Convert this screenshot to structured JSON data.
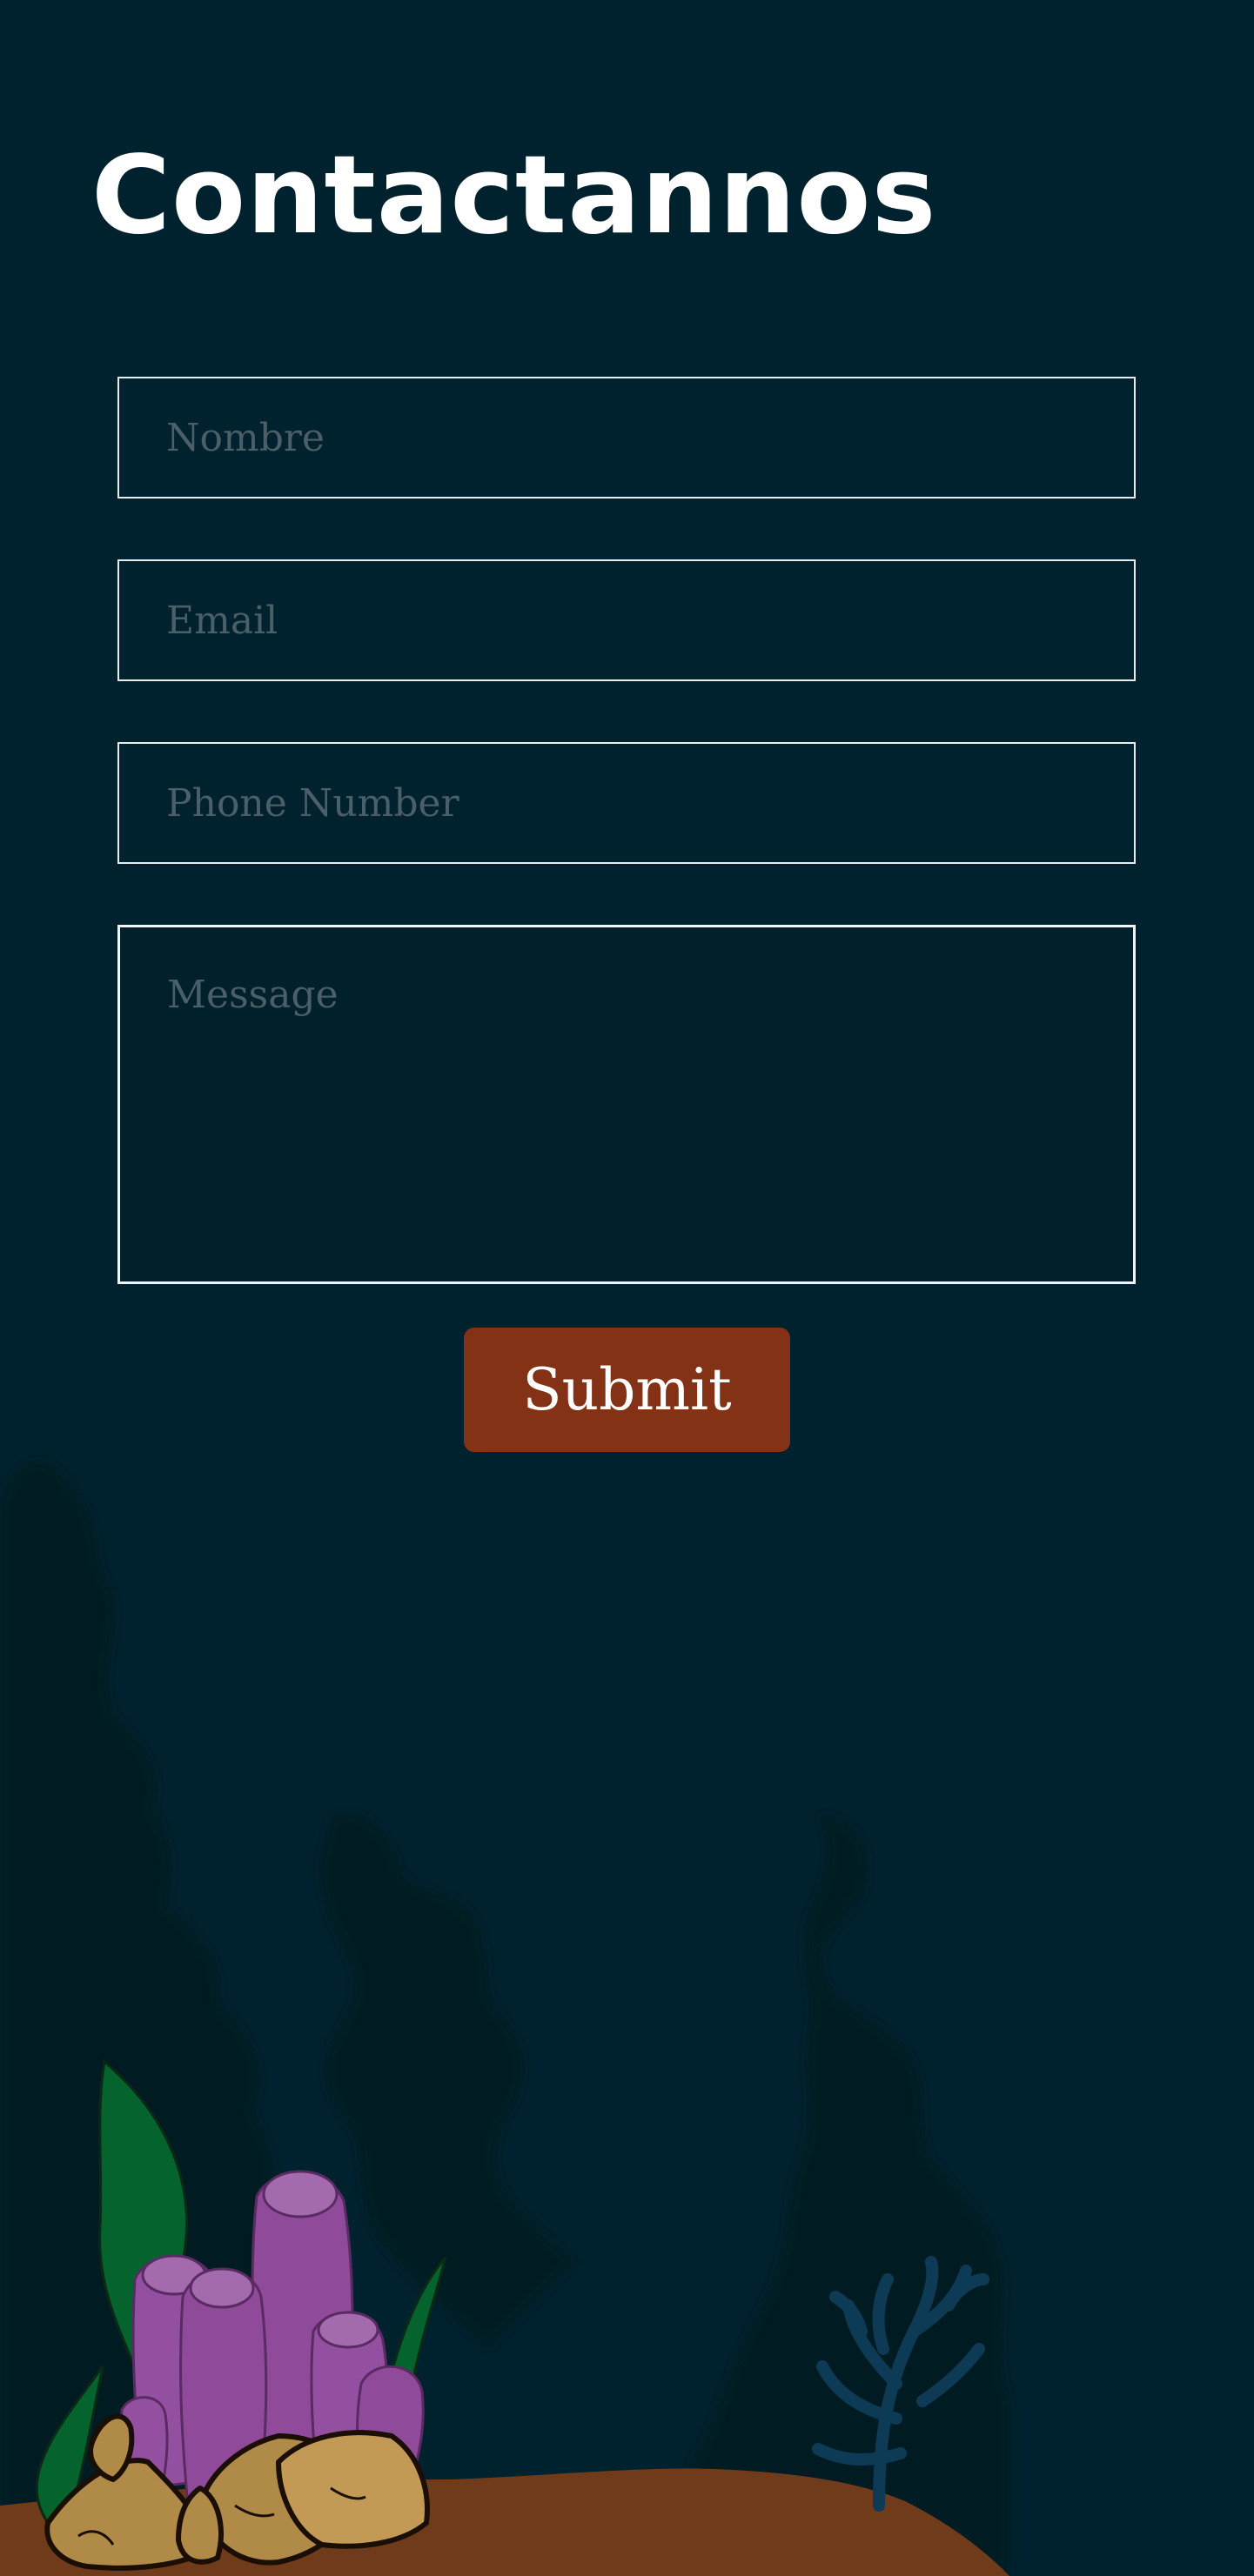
{
  "page": {
    "title": "Contactannos",
    "background_color": "#00222f"
  },
  "form": {
    "name_placeholder": "Nombre",
    "email_placeholder": "Email",
    "phone_placeholder": "Phone Number",
    "message_placeholder": "Message",
    "submit_label": "Submit",
    "submit_color": "#843216"
  },
  "illustration": {
    "icons": [
      "kelp-silhouette-icon",
      "seaweed-icon",
      "purple-coral-icon",
      "blue-coral-icon",
      "rock-icon",
      "sand-mound-icon"
    ]
  }
}
